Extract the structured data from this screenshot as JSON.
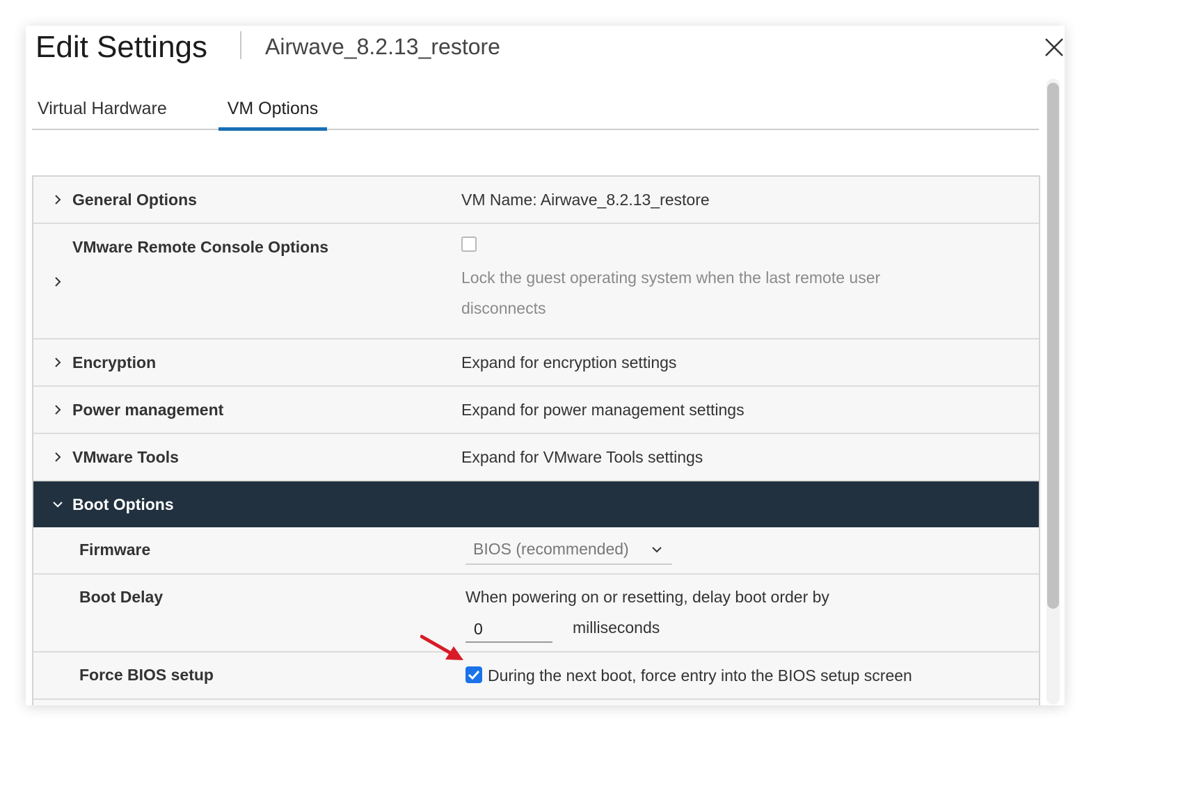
{
  "dialog": {
    "title": "Edit Settings",
    "subtitle": "Airwave_8.2.13_restore",
    "close_icon": "close-icon"
  },
  "tabs": [
    {
      "label": "Virtual Hardware",
      "active": false
    },
    {
      "label": "VM Options",
      "active": true
    }
  ],
  "sections": {
    "general": {
      "label": "General Options",
      "value": "VM Name: Airwave_8.2.13_restore"
    },
    "remote_console": {
      "label": "VMware Remote Console Options",
      "checked": false,
      "line1": "Lock the guest operating system when the last remote user",
      "line2": "disconnects"
    },
    "encryption": {
      "label": "Encryption",
      "value": "Expand for encryption settings"
    },
    "power": {
      "label": "Power management",
      "value": "Expand for power management settings"
    },
    "tools": {
      "label": "VMware Tools",
      "value": "Expand for VMware Tools settings"
    },
    "boot": {
      "label": "Boot Options",
      "firmware": {
        "label": "Firmware",
        "selected": "BIOS (recommended)"
      },
      "boot_delay": {
        "label": "Boot Delay",
        "text": "When powering on or resetting, delay boot order by",
        "value": "0",
        "unit": "milliseconds"
      },
      "force_bios": {
        "label": "Force BIOS setup",
        "checked": true,
        "text": "During the next boot, force entry into the BIOS setup screen"
      }
    }
  },
  "colors": {
    "accent": "#1a6eb5",
    "boot_header_bg": "#21313f",
    "checkbox": "#1a73e8",
    "annotation_arrow": "#d81b27"
  }
}
